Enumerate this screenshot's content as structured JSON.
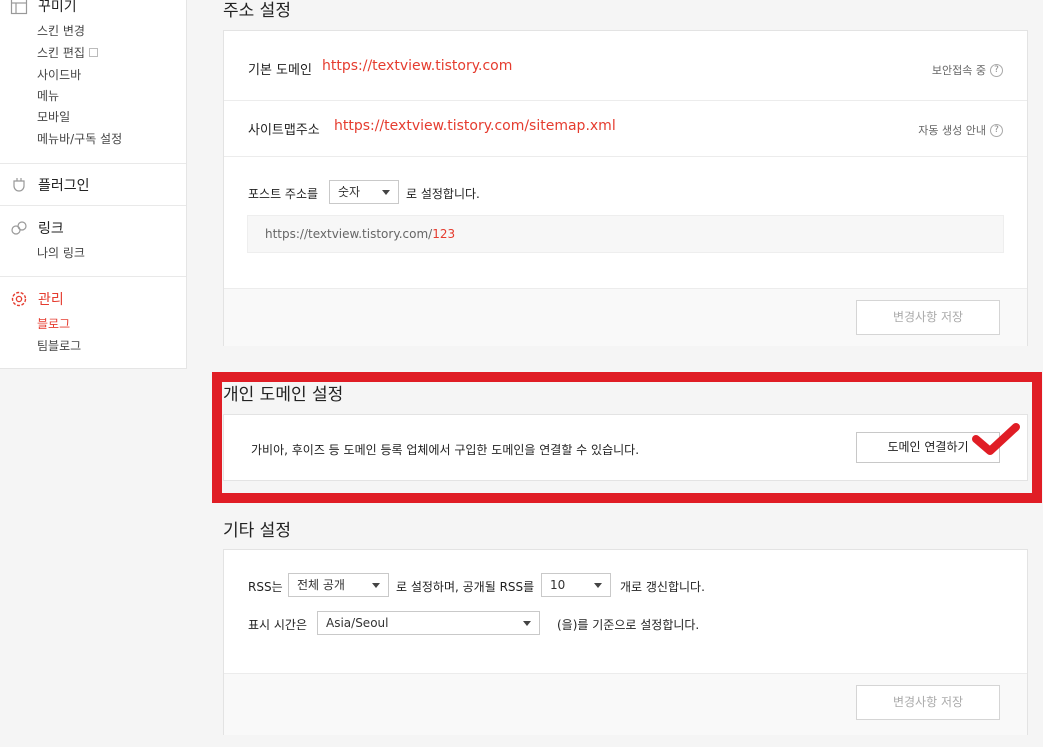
{
  "sidebar": {
    "decorate": {
      "title": "꾸미기",
      "items": [
        "스킨 변경",
        "스킨 편집",
        "사이드바",
        "메뉴",
        "모바일",
        "메뉴바/구독 설정"
      ]
    },
    "plugin": {
      "title": "플러그인"
    },
    "link": {
      "title": "링크",
      "items": [
        "나의 링크"
      ]
    },
    "manage": {
      "title": "관리",
      "items": [
        "블로그",
        "팀블로그"
      ]
    }
  },
  "address": {
    "section_title": "주소 설정",
    "default_domain_label": "기본 도메인",
    "default_domain_url": "https://textview.tistory.com",
    "secure_label": "보안접속 중",
    "sitemap_label": "사이트맵주소",
    "sitemap_url": "https://textview.tistory.com/sitemap.xml",
    "sitemap_help": "자동 생성 안내",
    "post_addr_prefix": "포스트 주소를",
    "post_addr_select": "숫자",
    "post_addr_suffix": "로 설정합니다.",
    "example_url_base": "https://textview.tistory.com/",
    "example_url_num": "123",
    "save_label": "변경사항 저장"
  },
  "domain": {
    "section_title": "개인 도메인 설정",
    "description": "가비아, 후이즈 등 도메인 등록 업체에서 구입한 도메인을 연결할 수 있습니다.",
    "connect_label": "도메인 연결하기"
  },
  "other": {
    "section_title": "기타 설정",
    "rss_prefix": "RSS는",
    "rss_select": "전체 공개",
    "rss_middle": "로 설정하며, 공개될 RSS를",
    "rss_count": "10",
    "rss_suffix": "개로 갱신합니다.",
    "time_prefix": "표시 시간은",
    "time_select": "Asia/Seoul",
    "time_suffix": "(을)를 기준으로 설정합니다.",
    "save_label": "변경사항 저장"
  },
  "colors": {
    "accent": "#e53c2f",
    "highlight_box": "#e01d25"
  }
}
